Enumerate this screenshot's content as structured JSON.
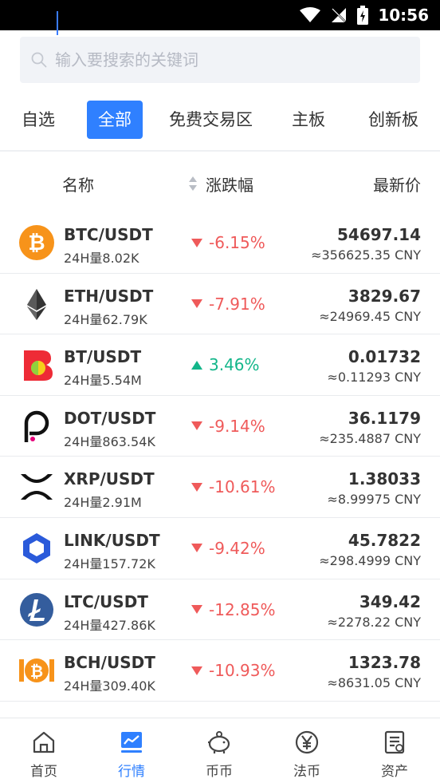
{
  "status_bar": {
    "time": "10:56"
  },
  "search": {
    "placeholder": "输入要搜索的关键词",
    "value": ""
  },
  "tabs": [
    {
      "label": "自选",
      "active": false
    },
    {
      "label": "全部",
      "active": true
    },
    {
      "label": "免费交易区",
      "active": false
    },
    {
      "label": "主板",
      "active": false
    },
    {
      "label": "创新板",
      "active": false
    }
  ],
  "columns": {
    "name": "名称",
    "change": "涨跌幅",
    "price": "最新价"
  },
  "rows": [
    {
      "pair": "BTC/USDT",
      "volume": "24H量8.02K",
      "change": "-6.15%",
      "direction": "down",
      "price": "54697.14",
      "cny": "≈356625.35 CNY",
      "icon": "bitcoin-icon"
    },
    {
      "pair": "ETH/USDT",
      "volume": "24H量62.79K",
      "change": "-7.91%",
      "direction": "down",
      "price": "3829.67",
      "cny": "≈24969.45 CNY",
      "icon": "ethereum-icon"
    },
    {
      "pair": "BT/USDT",
      "volume": "24H量5.54M",
      "change": "3.46%",
      "direction": "up",
      "price": "0.01732",
      "cny": "≈0.11293 CNY",
      "icon": "bt-icon"
    },
    {
      "pair": "DOT/USDT",
      "volume": "24H量863.54K",
      "change": "-9.14%",
      "direction": "down",
      "price": "36.1179",
      "cny": "≈235.4887 CNY",
      "icon": "polkadot-icon"
    },
    {
      "pair": "XRP/USDT",
      "volume": "24H量2.91M",
      "change": "-10.61%",
      "direction": "down",
      "price": "1.38033",
      "cny": "≈8.99975 CNY",
      "icon": "xrp-icon"
    },
    {
      "pair": "LINK/USDT",
      "volume": "24H量157.72K",
      "change": "-9.42%",
      "direction": "down",
      "price": "45.7822",
      "cny": "≈298.4999 CNY",
      "icon": "chainlink-icon"
    },
    {
      "pair": "LTC/USDT",
      "volume": "24H量427.86K",
      "change": "-12.85%",
      "direction": "down",
      "price": "349.42",
      "cny": "≈2278.22 CNY",
      "icon": "litecoin-icon"
    },
    {
      "pair": "BCH/USDT",
      "volume": "24H量309.40K",
      "change": "-10.93%",
      "direction": "down",
      "price": "1323.78",
      "cny": "≈8631.05 CNY",
      "icon": "bitcoin-cash-icon"
    }
  ],
  "nav": [
    {
      "label": "首页",
      "icon": "home-icon",
      "active": false
    },
    {
      "label": "行情",
      "icon": "chart-icon",
      "active": true
    },
    {
      "label": "币币",
      "icon": "piggy-bank-icon",
      "active": false
    },
    {
      "label": "法币",
      "icon": "yen-icon",
      "active": false
    },
    {
      "label": "资产",
      "icon": "document-icon",
      "active": false
    }
  ],
  "colors": {
    "accent": "#2f80ff",
    "down": "#ef5a5a",
    "up": "#13b68a"
  }
}
